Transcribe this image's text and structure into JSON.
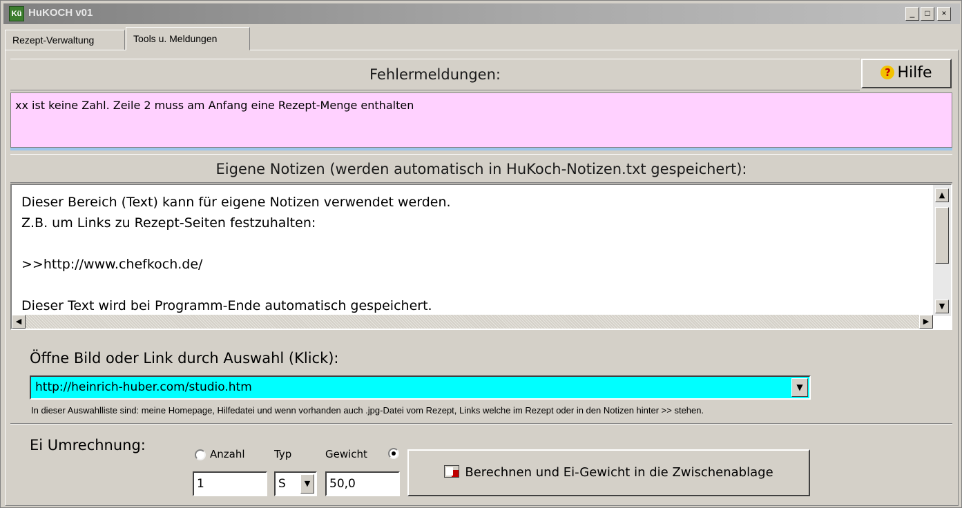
{
  "window": {
    "icon_text": "Kü",
    "title": "HuKOCH v01",
    "minimize": "_",
    "maximize": "□",
    "close": "×"
  },
  "tabs": [
    {
      "label": "Rezept-Verwaltung"
    },
    {
      "label": "Tools u. Meldungen"
    }
  ],
  "errors": {
    "header": "Fehlermeldungen:",
    "help_label": "Hilfe",
    "help_icon": "?",
    "message": "xx  ist keine Zahl. Zeile 2 muss am Anfang eine Rezept-Menge enthalten"
  },
  "notes": {
    "header": "Eigene Notizen (werden automatisch in HuKoch-Notizen.txt gespeichert):",
    "lines": [
      "Dieser Bereich (Text) kann für eigene Notizen verwendet werden.",
      "Z.B. um Links zu Rezept-Seiten festzuhalten:",
      "",
      ">>http://www.chefkoch.de/",
      "",
      "Dieser Text wird bei Programm-Ende automatisch gespeichert."
    ]
  },
  "open_link": {
    "label": "Öffne Bild oder Link durch Auswahl (Klick):",
    "selected": "http://heinrich-huber.com/studio.htm",
    "hint": "In dieser Auswahlliste sind: meine Homepage, Hilfedatei und wenn vorhanden auch  .jpg-Datei vom Rezept, Links welche im Rezept oder in den Notizen hinter >> stehen."
  },
  "egg": {
    "title": "Ei Umrechnung:",
    "anzahl_label": "Anzahl",
    "typ_label": "Typ",
    "gewicht_label": "Gewicht",
    "anzahl_value": "1",
    "typ_value": "S",
    "gewicht_value": "50,0",
    "selected_mode": "Gewicht",
    "calc_button": "Berechnen und Ei-Gewicht in die Zwischenablage"
  },
  "colors": {
    "error_bg": "#ffd1ff",
    "combo_bg": "#00ffff",
    "separator": "#9cc5ec"
  }
}
